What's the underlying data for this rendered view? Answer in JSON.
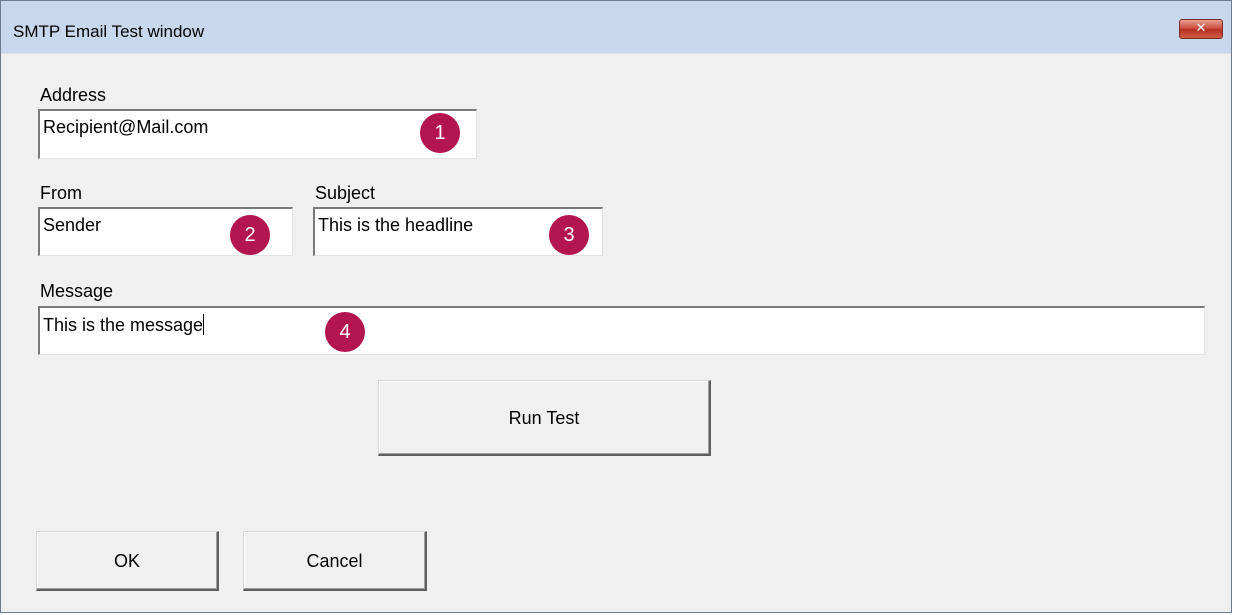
{
  "window": {
    "title": "SMTP Email Test window",
    "close_icon": "close-icon",
    "close_glyph": "✕",
    "close_color": "#c9473a"
  },
  "form": {
    "address": {
      "label": "Address",
      "value": "Recipient@Mail.com",
      "badge": "1"
    },
    "from": {
      "label": "From",
      "value": "Sender",
      "badge": "2"
    },
    "subject": {
      "label": "Subject",
      "value": "This is the headline",
      "badge": "3"
    },
    "message": {
      "label": "Message",
      "value": "This is the message",
      "badge": "4"
    },
    "badge_color": "#b3154f"
  },
  "buttons": {
    "run_test": "Run Test",
    "ok": "OK",
    "cancel": "Cancel"
  }
}
